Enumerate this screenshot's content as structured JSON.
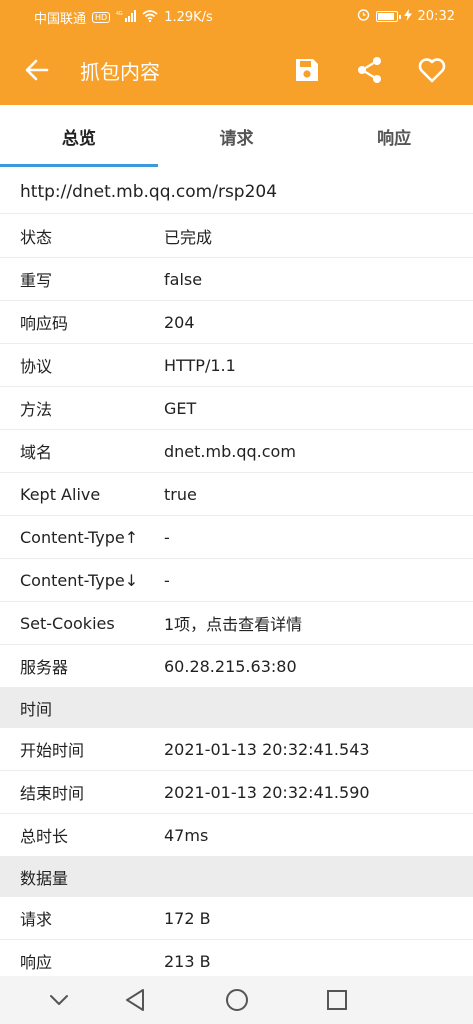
{
  "status_bar": {
    "carrier": "中国联通",
    "hd_badge": "HD",
    "network_label": "4G",
    "speed": "1.29K/s",
    "time": "20:32",
    "icons": [
      "signal-icon",
      "wifi-icon",
      "alarm-icon",
      "battery-icon",
      "charging-icon"
    ]
  },
  "app_bar": {
    "title": "抓包内容",
    "icons": [
      "back-arrow-icon",
      "save-icon",
      "share-icon",
      "heart-icon"
    ],
    "color": "#f8a12a"
  },
  "tabs": [
    {
      "label": "总览",
      "active": true
    },
    {
      "label": "请求",
      "active": false
    },
    {
      "label": "响应",
      "active": false
    }
  ],
  "url": "http://dnet.mb.qq.com/rsp204",
  "rows": [
    {
      "key": "状态",
      "value": "已完成"
    },
    {
      "key": "重写",
      "value": "false"
    },
    {
      "key": "响应码",
      "value": "204"
    },
    {
      "key": "协议",
      "value": "HTTP/1.1"
    },
    {
      "key": "方法",
      "value": "GET"
    },
    {
      "key": "域名",
      "value": "dnet.mb.qq.com"
    },
    {
      "key": "Kept Alive",
      "value": "true"
    },
    {
      "key": "Content-Type↑",
      "value": "-"
    },
    {
      "key": "Content-Type↓",
      "value": "-"
    },
    {
      "key": "Set-Cookies",
      "value": "1项，点击查看详情"
    },
    {
      "key": "服务器",
      "value": "60.28.215.63:80"
    }
  ],
  "time_section": {
    "title": "时间",
    "rows": [
      {
        "key": "开始时间",
        "value": "2021-01-13 20:32:41.543"
      },
      {
        "key": "结束时间",
        "value": "2021-01-13 20:32:41.590"
      },
      {
        "key": "总时长",
        "value": "47ms"
      }
    ]
  },
  "data_section": {
    "title": "数据量",
    "rows": [
      {
        "key": "请求",
        "value": "172 B"
      },
      {
        "key": "响应",
        "value": "213 B"
      }
    ]
  },
  "nav_bar": {
    "icons": [
      "chevron-down-icon",
      "nav-back-icon",
      "nav-home-icon",
      "nav-recent-icon"
    ]
  },
  "colors": {
    "accent": "#f8a12a",
    "tab_indicator": "#3b9ad9",
    "section_bg": "#ececec"
  }
}
